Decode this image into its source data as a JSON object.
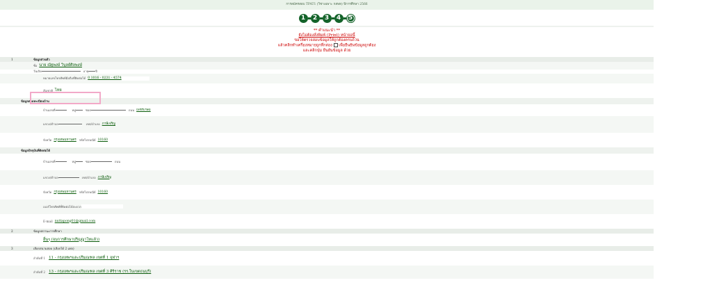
{
  "header": {
    "title": "การสมัครสอบ TPAT1 (วิชาเฉพาะ กสพท) ปีการศึกษา 2566",
    "steps": [
      "1",
      "2",
      "3",
      "4",
      "5"
    ]
  },
  "notice": {
    "line1": "** คำแนะนำ **",
    "line2": "ยังไม่ต้องสั่งพิมพ์ (Print) หน้าจอนี้",
    "line3": "ขอให้ตรวจสอบข้อมูลให้ถูกต้องครบถ้วน",
    "line4a": "แล้วคลิกทำเครื่องหมายถูกที่กล่อง",
    "line4b": "เพื่อยืนยันข้อมูลถูกต้อง",
    "line5": "และคลิกปุ่ม ยืนยันข้อมูล ด้วย"
  },
  "sections": {
    "personal": {
      "num": "1",
      "title": "ข้อมูลส่วนตัว"
    },
    "education": {
      "num": "2",
      "title": "ข้อมูลสถานะการศึกษา"
    },
    "venue": {
      "num": "3",
      "title": "เลือกสนามสอบ (เลือกได้ 2 แห่ง)"
    }
  },
  "personal": {
    "name_label": "ชื่อ",
    "name_value": "นาย ณัฐพงษ์ วิบูลย์ศิลพงษ์",
    "dob_label": "วันเกิด",
    "age_label": "อายุ",
    "age_unit": "ปี",
    "phone_label": "หมายเลขโทรศัพท์มือถือที่ติดต่อได้",
    "phone_value": "0 1016 - 0231 - 4574",
    "nationality_label": "สัญชาติ",
    "nationality_value": "ไทย"
  },
  "registered_address": {
    "title": "ข้อมูลตามทะเบียนบ้าน",
    "house_label": "บ้านเลขที่",
    "moo_label": "หมู่",
    "soi_label": "ซอย",
    "road_label": "ถนน",
    "road_value": "เพชรเกษม",
    "subdistrict_label": "แขวง/ตำบล",
    "district_label": "เขต/อำเภอ",
    "district_value": "ภาษีเจริญ",
    "province_label": "จังหวัด",
    "province_value": "กรุงเทพมหานคร",
    "postcode_label": "รหัสไปรษณีย์",
    "postcode_value": "10160"
  },
  "contact_address": {
    "title": "ข้อมูลปัจจุบันที่ติดต่อได้",
    "house_label": "บ้านเลขที่",
    "moo_label": "หมู่",
    "soi_label": "ซอย",
    "road_label": "ถนน",
    "subdistrict_label": "แขวง/ตำบล",
    "district_label": "เขต/อำเภอ",
    "district_value": "ภาษีเจริญ",
    "province_label": "จังหวัด",
    "province_value": "กรุงเทพมหานคร",
    "postcode_label": "รหัสไปรษณีย์",
    "postcode_value": "10160",
    "phone_label": "เบอร์โทรศัพท์ที่ติดต่อได้สะดวก",
    "email_label": "E-mail",
    "email_value": "nuttapong01@gmail.com"
  },
  "education": {
    "value": "อื่นๆ (จบการศึกษาปริญญาโทแล้ว)"
  },
  "venues": [
    {
      "label": "ลำดับที่ 1",
      "value": "11 - กรุงเทพฯและปริมณฑล เขตที่ 1 จุฬาฯ"
    },
    {
      "label": "ลำดับที่ 2",
      "value": "13 - กรุงเทพฯและปริมณฑล เขตที่ 3 ศิริราช (รร.ในเขตธนบุรี)"
    }
  ],
  "colors": {
    "step": "#14632a",
    "notice": "#cc0000",
    "value": "#0a5c0a",
    "highlight": "#f2a9c8"
  }
}
